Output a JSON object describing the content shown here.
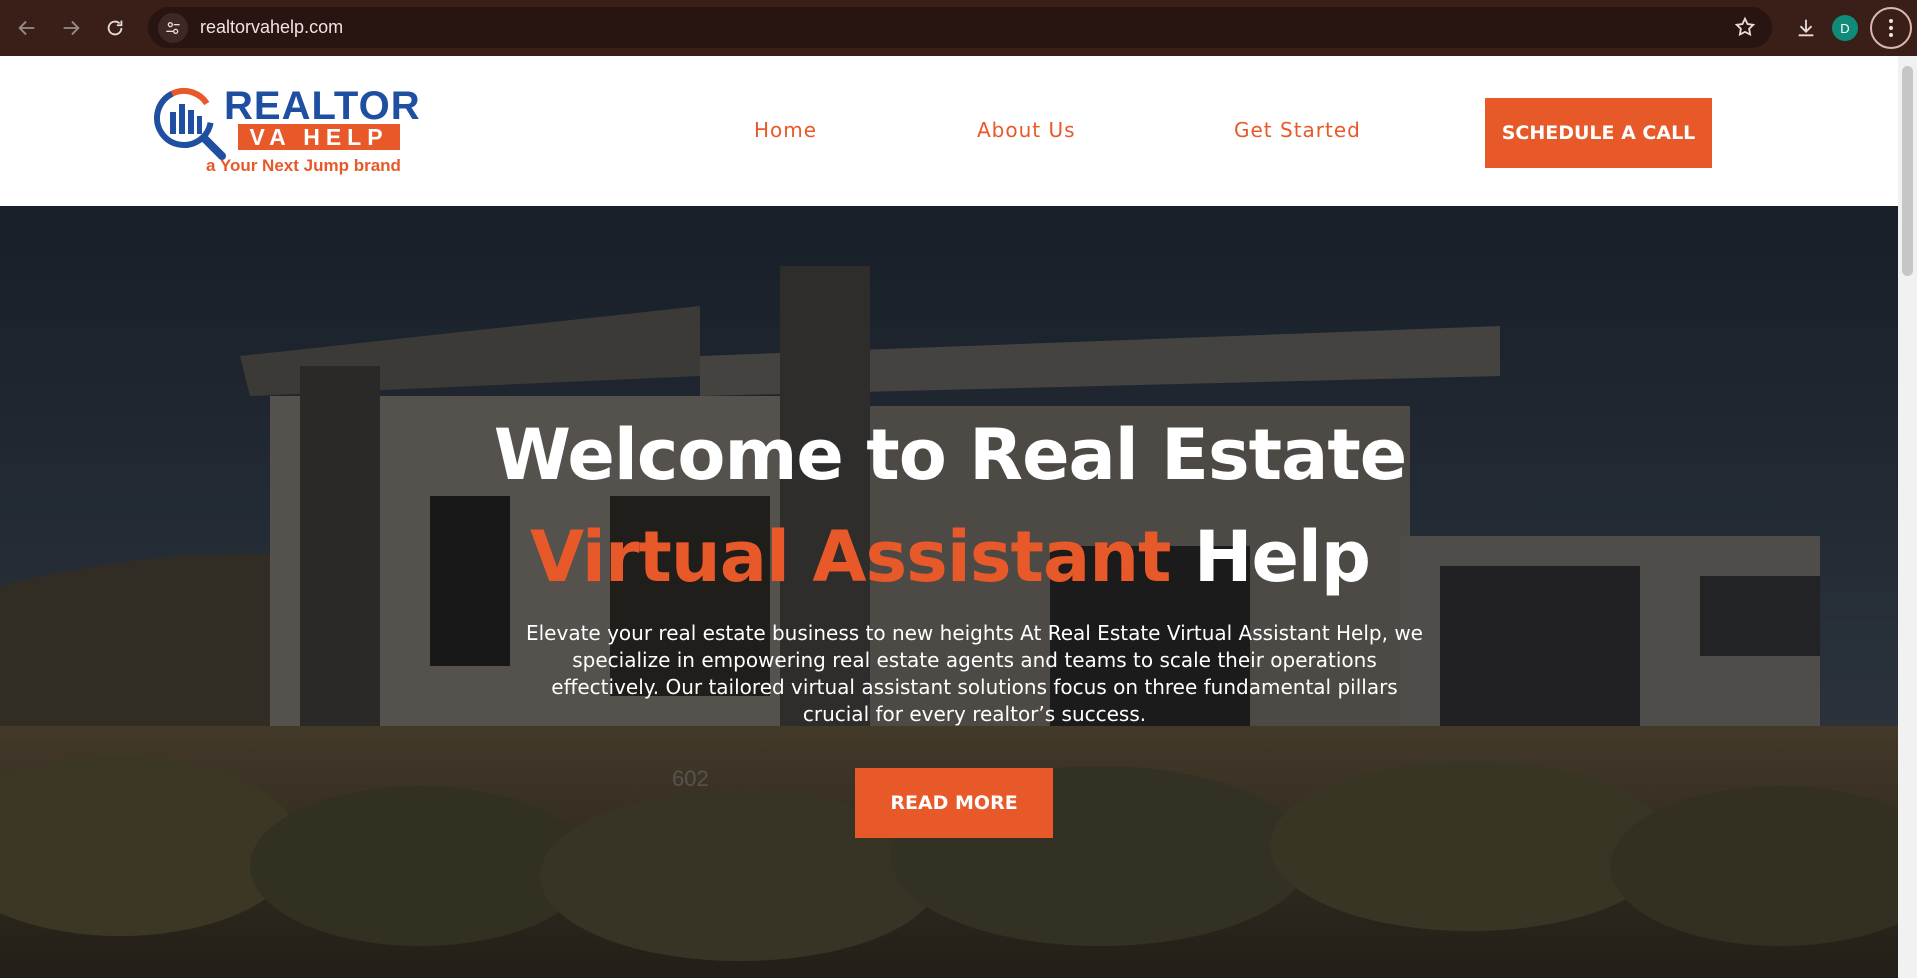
{
  "browser": {
    "url": "realtorvahelp.com",
    "profile_initial": "D",
    "icons": {
      "back": "arrow-left-icon",
      "forward": "arrow-right-icon",
      "reload": "reload-icon",
      "site_info": "tune-icon",
      "bookmark": "star-icon",
      "downloads": "download-icon",
      "menu": "kebab-menu-icon"
    }
  },
  "header": {
    "logo": {
      "word": "REALTOR",
      "sub": "VA HELP",
      "tagline": "a Your Next Jump brand"
    },
    "nav": [
      {
        "label": "Home"
      },
      {
        "label": "About Us"
      },
      {
        "label": "Get Started"
      }
    ],
    "cta_label": "SCHEDULE A CALL"
  },
  "hero": {
    "title_line1": "Welcome to Real Estate",
    "title_accent": "Virtual Assistant",
    "title_plain": "Help",
    "description": "Elevate your real estate business to new heights At Real Estate Virtual Assistant Help, we specialize in empowering real estate agents and teams to scale their operations effectively. Our tailored virtual assistant solutions focus on three fundamental pillars crucial for every realtor’s success.",
    "house_number": "602",
    "button_label": "READ MORE"
  },
  "colors": {
    "accent": "#e8592a",
    "brand_blue": "#1f4fa0",
    "chrome": "#3a1f19"
  }
}
